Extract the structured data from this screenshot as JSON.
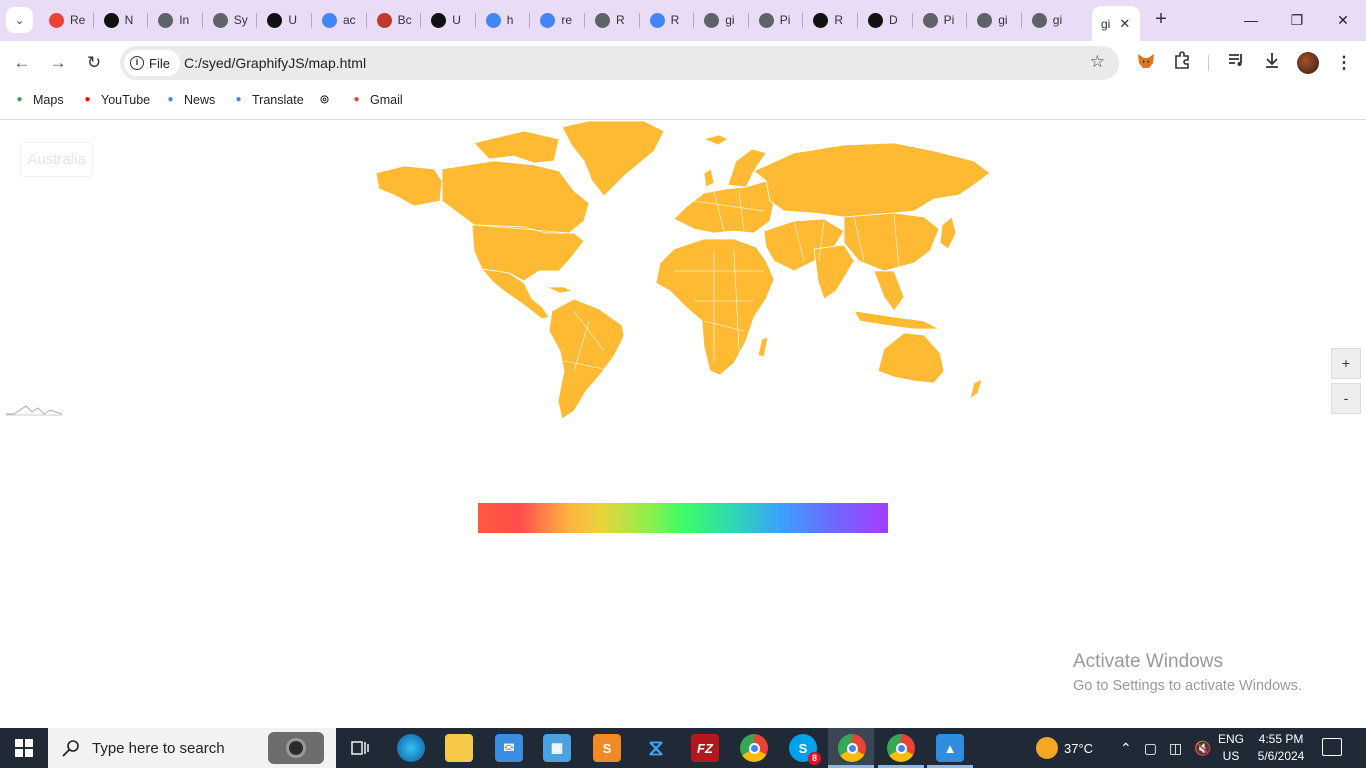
{
  "browser": {
    "tabs": [
      {
        "text": "Re",
        "icon": "gmail-icon",
        "color": "#ea4335"
      },
      {
        "text": "N",
        "icon": "notion-like-icon",
        "color": "#111111"
      },
      {
        "text": "In",
        "icon": "globe-icon",
        "color": "#5f6368"
      },
      {
        "text": "Sy",
        "icon": "globe-icon",
        "color": "#5f6368"
      },
      {
        "text": "U",
        "icon": "app-icon",
        "color": "#111111"
      },
      {
        "text": "ac",
        "icon": "google-icon",
        "color": "#4285f4"
      },
      {
        "text": "Bc",
        "icon": "b-icon",
        "color": "#c0392b"
      },
      {
        "text": "U",
        "icon": "github-icon",
        "color": "#111111"
      },
      {
        "text": "h",
        "icon": "google-icon",
        "color": "#4285f4"
      },
      {
        "text": "re",
        "icon": "google-icon",
        "color": "#4285f4"
      },
      {
        "text": "R",
        "icon": "globe-icon",
        "color": "#5f6368"
      },
      {
        "text": "R",
        "icon": "google-icon",
        "color": "#4285f4"
      },
      {
        "text": "gi",
        "icon": "globe-icon",
        "color": "#5f6368"
      },
      {
        "text": "Pi",
        "icon": "globe-icon",
        "color": "#5f6368"
      },
      {
        "text": "R",
        "icon": "github-icon",
        "color": "#111111"
      },
      {
        "text": "D",
        "icon": "github-icon",
        "color": "#111111"
      },
      {
        "text": "Pi",
        "icon": "globe-icon",
        "color": "#5f6368"
      },
      {
        "text": "gi",
        "icon": "globe-icon",
        "color": "#5f6368"
      },
      {
        "text": "gi",
        "icon": "globe-icon",
        "color": "#5f6368"
      }
    ],
    "active_tab": {
      "text": "gi",
      "close": "✕"
    },
    "new_tab": "+",
    "address": {
      "chip": "File",
      "url": "C:/syed/GraphifyJS/map.html"
    },
    "bookmarks": [
      {
        "label": "Maps",
        "icon": "maps-pin-icon",
        "color": "#34a853"
      },
      {
        "label": "YouTube",
        "icon": "youtube-icon",
        "color": "#ff0000"
      },
      {
        "label": "News",
        "icon": "google-news-icon",
        "color": "#4285f4"
      },
      {
        "label": "Translate",
        "icon": "translate-icon",
        "color": "#4285f4"
      },
      {
        "label": "Gmail",
        "icon": "gmail-icon",
        "color": "#ea4335"
      }
    ]
  },
  "page": {
    "tooltip": "Australia",
    "map_color": "#ffba33",
    "zoom_in": "+",
    "zoom_out": "-"
  },
  "watermark": {
    "line1": "Activate Windows",
    "line2": "Go to Settings to activate Windows."
  },
  "taskbar": {
    "search_placeholder": "Type here to search",
    "weather": "37°C",
    "lang1": "ENG",
    "lang2": "US",
    "time": "4:55 PM",
    "date": "5/6/2024",
    "skype_badge": "8"
  }
}
